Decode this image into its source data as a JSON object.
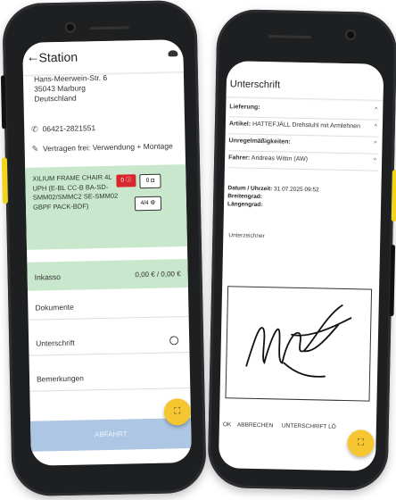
{
  "left": {
    "header": {
      "back_arrow": "←",
      "title": "Station",
      "cloud_icon": "cloud-icon"
    },
    "address": {
      "street": "Hans-Meerwein-Str. 6",
      "zip_city": "35043 Marburg",
      "country": "Deutschland"
    },
    "phone": "06421-2821551",
    "contract": "Vertragen frei: Verwendung + Montage",
    "product": {
      "text": "XILIUM FRAME CHAIR 4L UPH (E-BL CC-B BA-SD-SMM02/SMMC2 SE-SMM02 GBPF PACK-BDF)",
      "red_button": "0 ⓘ",
      "photo_button": "0 ◘",
      "check_button": "4/4 ⚙"
    },
    "inkasso": {
      "label": "Inkasso",
      "value": "0,00 € / 0,00 €"
    },
    "rows": {
      "dokumente": "Dokumente",
      "unterschrift": "Unterschrift",
      "bemerkungen": "Bemerkungen"
    },
    "abfahrt": "ABFAHRT",
    "fab": "⛶",
    "colors": {
      "green": "#c9e7cc",
      "red": "#d8262e",
      "blue": "#adc6e4",
      "fab": "#f5c630"
    }
  },
  "right": {
    "header": {
      "title": "Unterschrift"
    },
    "lines": {
      "lieferung": "Lieferung:",
      "artikel_label": "Artikel:",
      "artikel_value": "HATTEFJÄLL Drehstuhl mit Armlehnen",
      "unregel": "Unregelmäßigkeiten:",
      "fahrer_label": "Fahrer:",
      "fahrer_value": "Andreas Wittin (AW)",
      "chevron": "^"
    },
    "datetime": {
      "label": "Datum / Uhrzeit:",
      "value": "31.07.2025 09:52",
      "breitengrad": "Breitengrad:",
      "laengengrad": "Längengrad:"
    },
    "unterzeichner": "Unterzeichner",
    "actions": {
      "ok": "OK",
      "abbrechen": "ABBRECHEN",
      "unterschrift_loeschen": "UNTERSCHRIFT LÖ"
    },
    "fab": "⛶"
  }
}
